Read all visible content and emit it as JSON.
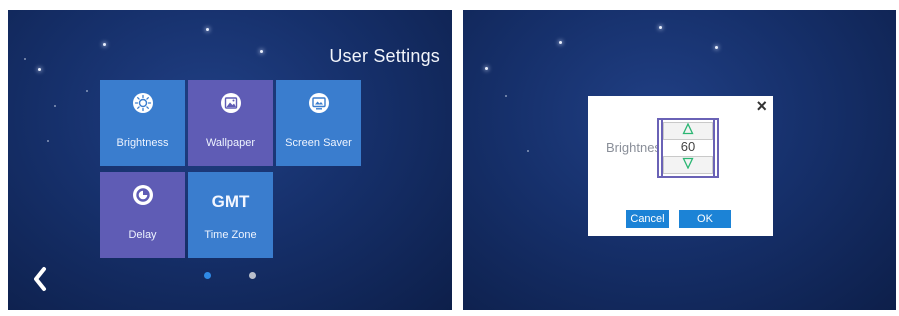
{
  "left_screen": {
    "title": "User Settings",
    "tiles": [
      {
        "label": "Brightness",
        "icon": "brightness-icon",
        "color": "#3a7dce"
      },
      {
        "label": "Wallpaper",
        "icon": "wallpaper-icon",
        "color": "#5f5cb5"
      },
      {
        "label": "Screen Saver",
        "icon": "screen-saver-icon",
        "color": "#3a7dce"
      },
      {
        "label": "Delay",
        "icon": "delay-icon",
        "color": "#5f5cb5"
      },
      {
        "label": "Time Zone",
        "icon_text": "GMT",
        "color": "#3a7dce"
      }
    ],
    "back_icon": "chevron-left-icon",
    "pagination": {
      "current_page": 1,
      "total_pages": 2
    }
  },
  "dialog": {
    "label": "Brightnes",
    "value": "60",
    "up_icon": "arrow-up-icon",
    "down_icon": "arrow-down-icon",
    "cancel_label": "Cancel",
    "ok_label": "OK",
    "close_glyph": "×"
  },
  "colors": {
    "background": "#16306b",
    "tile_blue": "#3a7dce",
    "tile_purple": "#5f5cb5",
    "accent": "#1c83d6",
    "active_dot": "#2f8ae6"
  }
}
